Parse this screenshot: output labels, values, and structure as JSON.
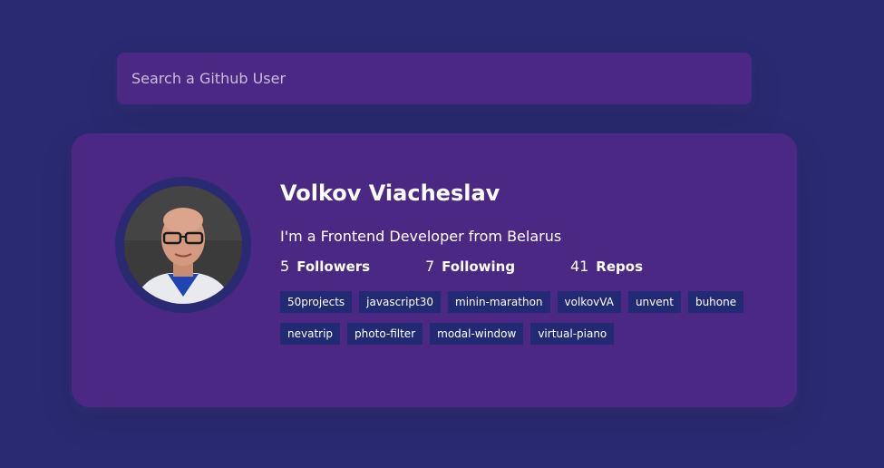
{
  "search": {
    "placeholder": "Search a Github User"
  },
  "profile": {
    "avatar": "user-avatar-photo",
    "name": "Volkov Viacheslav",
    "bio": "I'm a Frontend Developer from Belarus",
    "stats": [
      {
        "value": "5",
        "label": "Followers"
      },
      {
        "value": "7",
        "label": "Following"
      },
      {
        "value": "41",
        "label": "Repos"
      }
    ],
    "repos": [
      "50projects",
      "javascript30",
      "minin-marathon",
      "volkovVA",
      "unvent",
      "buhone",
      "nevatrip",
      "photo-filter",
      "modal-window",
      "virtual-piano"
    ]
  },
  "colors": {
    "background": "#2a2a72",
    "card": "#4c2885",
    "repo_tag": "#212a72",
    "text": "#ffffff"
  }
}
